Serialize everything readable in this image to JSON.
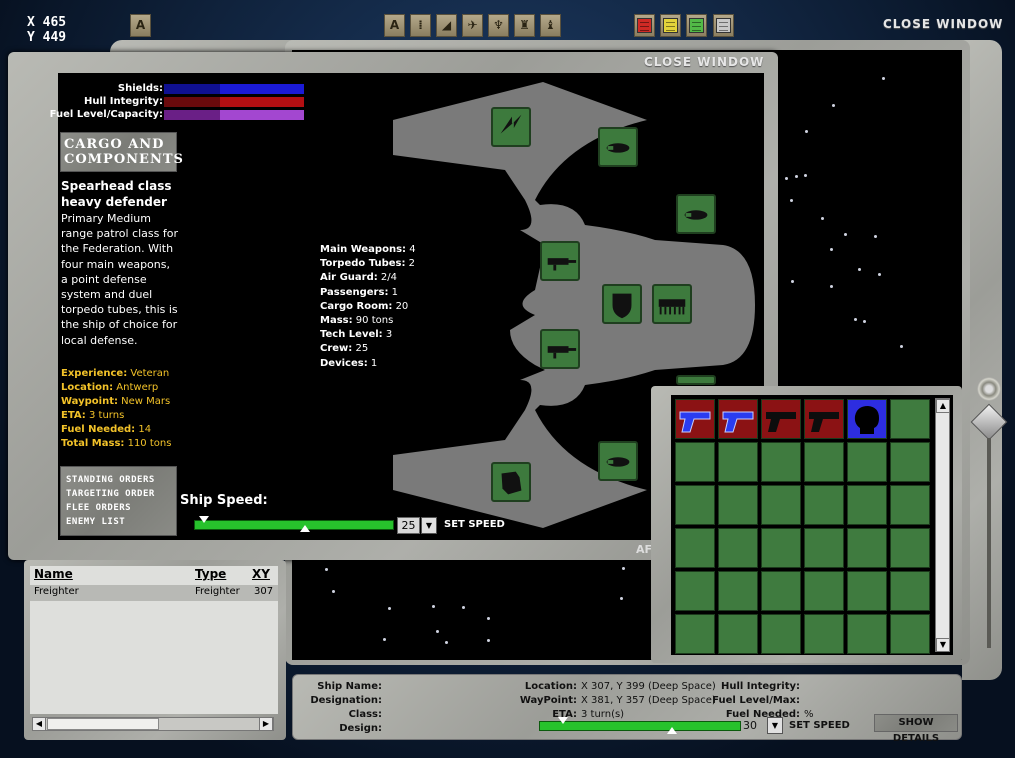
{
  "coords": {
    "x_label": "X",
    "x_value": "465",
    "y_label": "Y",
    "y_value": "449"
  },
  "toolbar": {
    "left_btn": "A",
    "filters": [
      {
        "icon": "letter-a-icon",
        "glyph": "A"
      },
      {
        "icon": "figure-icon",
        "glyph": "⁞"
      },
      {
        "icon": "small-ship-icon",
        "glyph": "◢"
      },
      {
        "icon": "fighter-icon",
        "glyph": "✈"
      },
      {
        "icon": "cruiser-icon",
        "glyph": "♆"
      },
      {
        "icon": "carrier-icon",
        "glyph": "♜"
      },
      {
        "icon": "station-icon",
        "glyph": "♝"
      }
    ],
    "colors": [
      {
        "icon": "red-filter-icon",
        "color": "#d02a25"
      },
      {
        "icon": "yellow-filter-icon",
        "color": "#e2d23a"
      },
      {
        "icon": "green-filter-icon",
        "color": "#52b947"
      },
      {
        "icon": "white-filter-icon",
        "color": "#c8c8c8"
      }
    ],
    "close_label": "CLOSE WINDOW"
  },
  "ship_window": {
    "close_label": "CLOSE WINDOW",
    "bars": [
      {
        "label": "Shields:",
        "fill": "#1a1ad6",
        "dark": "#0f1090",
        "value": 1.0
      },
      {
        "label": "Hull Integrity:",
        "fill": "#b30f12",
        "dark": "#6a0a0c",
        "value": 1.0
      },
      {
        "label": "Fuel Level/Capacity:",
        "fill": "#a347d0",
        "dark": "#6a1f86",
        "value": 1.0
      }
    ],
    "cargo_button": [
      "CARGO AND",
      "COMPONENTS"
    ],
    "ship_class": [
      "Spearhead class",
      "heavy defender"
    ],
    "description": [
      "Primary Medium",
      "range patrol class for",
      "the Federation. With",
      "four main weapons,",
      "a point defense",
      "system and duel",
      "torpedo tubes, this is",
      "the ship of choice for",
      "local defense."
    ],
    "status": [
      {
        "label": "Experience:",
        "value": "Veteran"
      },
      {
        "label": "Location:",
        "value": "Antwerp"
      },
      {
        "label": "Waypoint:",
        "value": "New Mars"
      },
      {
        "label": "ETA:",
        "value": "3 turns"
      },
      {
        "label": "Fuel Needed:",
        "value": "14"
      },
      {
        "label": "Total Mass:",
        "value": "110 tons"
      }
    ],
    "stats": [
      {
        "label": "Main Weapons:",
        "value": "4"
      },
      {
        "label": "Torpedo Tubes:",
        "value": "2"
      },
      {
        "label": "Air Guard:",
        "value": "2/4"
      },
      {
        "label": "Passengers:",
        "value": "1"
      },
      {
        "label": "Cargo Room:",
        "value": "20"
      },
      {
        "label": "Mass:",
        "value": "90 tons"
      },
      {
        "label": "Tech Level:",
        "value": "3"
      },
      {
        "label": "Crew:",
        "value": "25"
      },
      {
        "label": "Devices:",
        "value": "1"
      }
    ],
    "orders": [
      "STANDING ORDERS",
      "TARGETING ORDER",
      "FLEE ORDERS",
      "ENEMY LIST"
    ],
    "speed_label": "Ship Speed:",
    "speed_value": "25",
    "speed_fraction": 0.05,
    "set_speed": "SET SPEED",
    "slot_icons": [
      "lightning-icon",
      "torpedo-icon",
      "torpedo-icon",
      "cannon-icon",
      "cannon-icon",
      "cannon-icon",
      "shield-icon",
      "comb-device-icon",
      "cargo-pod-icon",
      "torpedo-icon"
    ]
  },
  "cargo_grid": {
    "items": [
      {
        "icon": "blue-pistol-icon",
        "bg": "#8b1214"
      },
      {
        "icon": "blue-pistol-icon",
        "bg": "#8b1214"
      },
      {
        "icon": "black-pistol-icon",
        "bg": "#8b1214"
      },
      {
        "icon": "black-pistol-icon",
        "bg": "#8b1214"
      },
      {
        "icon": "head-silhouette-icon",
        "bg": "#2d2de0"
      }
    ]
  },
  "partial_label": "AF",
  "ship_list": {
    "headers": [
      "Name",
      "Type",
      "XY"
    ],
    "rows": [
      {
        "name": "Freighter",
        "type": "Freighter",
        "xy": "307"
      }
    ]
  },
  "info_panel": {
    "left": [
      {
        "label": "Ship Name:",
        "value": ""
      },
      {
        "label": "Designation:",
        "value": ""
      },
      {
        "label": "Class:",
        "value": ""
      },
      {
        "label": "Design:",
        "value": ""
      }
    ],
    "mid": [
      {
        "label": "Location:",
        "value": "X 307, Y 399 (Deep Space)"
      },
      {
        "label": "WayPoint:",
        "value": "X 381, Y 357 (Deep Space)"
      },
      {
        "label": "ETA:",
        "value": "3 turn(s)"
      }
    ],
    "right": [
      {
        "label": "Hull Integrity:",
        "value": ""
      },
      {
        "label": "Fuel Level/Max:",
        "value": ""
      },
      {
        "label": "Fuel Needed:",
        "value": "%"
      }
    ],
    "speed_value": "30",
    "speed_fraction": 0.12,
    "set_speed": "SET SPEED",
    "show_details": "SHOW DETAILS"
  }
}
